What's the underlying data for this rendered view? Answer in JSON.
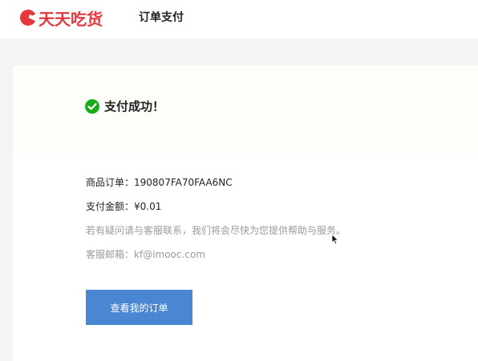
{
  "header": {
    "logo_text": "天天吃货",
    "page_title": "订单支付"
  },
  "result": {
    "status_text": "支付成功！",
    "order_label": "商品订单：",
    "order_id": "190807FA70FAA6NC",
    "amount_label": "支付金额：",
    "amount": "¥0.01",
    "notice": "若有疑问请与客服联系，我们将会尽快为您提供帮助与服务。",
    "email_label": "客服邮箱：",
    "email": "kf@imooc.com",
    "view_orders_label": "查看我的订单"
  },
  "colors": {
    "brand": "#e4393c",
    "success": "#1aad19",
    "button": "#4a86d2"
  }
}
